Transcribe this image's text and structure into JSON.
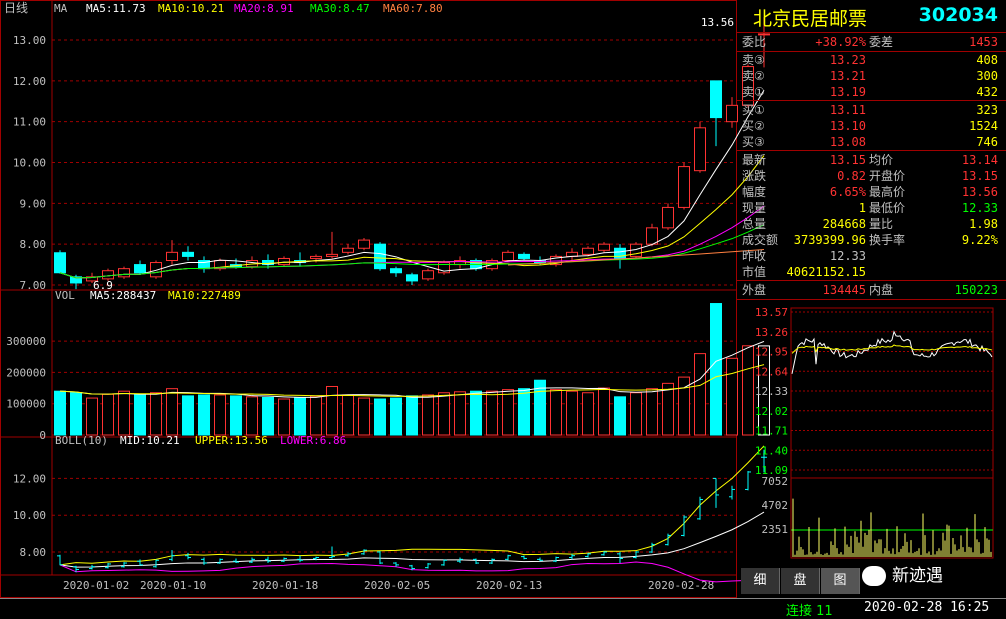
{
  "header": {
    "period": "日线",
    "ma_label": "MA",
    "ma5": "MA5:11.73",
    "ma10": "MA10:10.21",
    "ma20": "MA20:8.91",
    "ma30": "MA30:8.47",
    "ma60": "MA60:7.80"
  },
  "colors": {
    "up": "#ff3232",
    "down": "#00ffff",
    "ma5": "#ffffff",
    "ma10": "#ffff00",
    "ma20": "#ff00ff",
    "ma30": "#00ff00",
    "ma60": "#ff8040",
    "grid": "#a00000",
    "axis_text": "#c0c0c0"
  },
  "price_axis": {
    "ticks": [
      "13.00",
      "12.00",
      "11.00",
      "10.00",
      "9.00",
      "8.00",
      "7.00"
    ]
  },
  "price_annotations": {
    "high": "13.56",
    "low": "6.9"
  },
  "volume": {
    "label": "VOL",
    "ma5": "MA5:288437",
    "ma10": "MA10:227489",
    "ticks": [
      "300000",
      "200000",
      "100000",
      "0"
    ]
  },
  "boll": {
    "label": "BOLL(10)",
    "mid": "MID:10.21",
    "upper": "UPPER:13.56",
    "lower": "LOWER:6.86",
    "ticks": [
      "12.00",
      "10.00",
      "8.00"
    ]
  },
  "dates": [
    "2020-01-02",
    "2020-01-10",
    "2020-01-18",
    "2020-02-05",
    "2020-02-13",
    "2020-02-28"
  ],
  "stock": {
    "name": "北京民居邮票",
    "code": "302034"
  },
  "quote": {
    "weibi_label": "委比",
    "weibi": "+38.92%",
    "weicha_label": "委差",
    "weicha": "1453",
    "sells": [
      {
        "label": "卖③",
        "price": "13.23",
        "vol": "408"
      },
      {
        "label": "卖②",
        "price": "13.21",
        "vol": "300"
      },
      {
        "label": "卖①",
        "price": "13.19",
        "vol": "432"
      }
    ],
    "buys": [
      {
        "label": "买①",
        "price": "13.11",
        "vol": "323"
      },
      {
        "label": "买②",
        "price": "13.10",
        "vol": "1524"
      },
      {
        "label": "买③",
        "price": "13.08",
        "vol": "746"
      }
    ],
    "stats": [
      {
        "l1": "最新",
        "v1": "13.15",
        "l2": "均价",
        "v2": "13.14"
      },
      {
        "l1": "涨跌",
        "v1": "0.82",
        "l2": "开盘价",
        "v2": "13.15"
      },
      {
        "l1": "幅度",
        "v1": "6.65%",
        "l2": "最高价",
        "v2": "13.56"
      },
      {
        "l1": "现量",
        "v1": "1",
        "l2": "最低价",
        "v2": "12.33"
      },
      {
        "l1": "总量",
        "v1": "284668",
        "l2": "量比",
        "v2": "1.98"
      },
      {
        "l1": "成交额",
        "v1": "3739399.96",
        "l2": "换手率",
        "v2": "9.22%"
      },
      {
        "l1": "昨收",
        "v1": "12.33",
        "l2": "",
        "v2": ""
      },
      {
        "l1": "市值",
        "v1": "40621152.15",
        "l2": "",
        "v2": ""
      }
    ],
    "waipan_label": "外盘",
    "waipan": "134445",
    "neipan_label": "内盘",
    "neipan": "150223"
  },
  "intraday": {
    "price_ticks": [
      "13.57",
      "13.26",
      "12.95",
      "12.64",
      "12.33",
      "12.02",
      "11.71",
      "11.40",
      "11.09"
    ],
    "vol_ticks": [
      "7052",
      "4702",
      "2351"
    ]
  },
  "tabs": [
    "细",
    "盘",
    "图"
  ],
  "watermark": "新迹遇",
  "status": {
    "connection": "连接 11",
    "datetime": "2020-02-28 16:25"
  },
  "chart_data": {
    "type": "candlestick",
    "candles": [
      [
        7.79,
        7.3,
        7.85,
        7.28
      ],
      [
        7.2,
        7.05,
        7.25,
        6.9
      ],
      [
        7.1,
        7.2,
        7.3,
        7.05
      ],
      [
        7.15,
        7.35,
        7.4,
        7.1
      ],
      [
        7.2,
        7.4,
        7.45,
        7.15
      ],
      [
        7.5,
        7.3,
        7.6,
        7.25
      ],
      [
        7.2,
        7.55,
        7.6,
        7.15
      ],
      [
        7.6,
        7.8,
        8.1,
        7.5
      ],
      [
        7.8,
        7.7,
        7.95,
        7.6
      ],
      [
        7.6,
        7.4,
        7.7,
        7.3
      ],
      [
        7.4,
        7.6,
        7.65,
        7.35
      ],
      [
        7.5,
        7.45,
        7.65,
        7.4
      ],
      [
        7.45,
        7.6,
        7.7,
        7.4
      ],
      [
        7.6,
        7.5,
        7.75,
        7.4
      ],
      [
        7.5,
        7.65,
        7.7,
        7.45
      ],
      [
        7.6,
        7.55,
        7.8,
        7.45
      ],
      [
        7.65,
        7.7,
        7.75,
        7.55
      ],
      [
        7.7,
        7.75,
        8.3,
        7.65
      ],
      [
        7.8,
        7.9,
        8.0,
        7.75
      ],
      [
        7.9,
        8.1,
        8.15,
        7.85
      ],
      [
        8.0,
        7.4,
        8.05,
        7.35
      ],
      [
        7.4,
        7.3,
        7.45,
        7.2
      ],
      [
        7.25,
        7.1,
        7.3,
        7.0
      ],
      [
        7.15,
        7.35,
        7.4,
        7.1
      ],
      [
        7.3,
        7.55,
        7.6,
        7.25
      ],
      [
        7.5,
        7.6,
        7.7,
        7.4
      ],
      [
        7.6,
        7.4,
        7.65,
        7.35
      ],
      [
        7.4,
        7.6,
        7.65,
        7.35
      ],
      [
        7.6,
        7.8,
        7.85,
        7.55
      ],
      [
        7.75,
        7.65,
        7.8,
        7.6
      ],
      [
        7.6,
        7.55,
        7.7,
        7.5
      ],
      [
        7.5,
        7.7,
        7.75,
        7.45
      ],
      [
        7.7,
        7.8,
        7.9,
        7.6
      ],
      [
        7.75,
        7.9,
        7.95,
        7.7
      ],
      [
        7.85,
        8.0,
        8.05,
        7.8
      ],
      [
        7.9,
        7.65,
        8.0,
        7.4
      ],
      [
        7.7,
        8.0,
        8.05,
        7.65
      ],
      [
        8.0,
        8.4,
        8.5,
        7.95
      ],
      [
        8.4,
        8.9,
        9.0,
        8.35
      ],
      [
        8.9,
        9.9,
        10.0,
        8.85
      ],
      [
        9.8,
        10.85,
        11.0,
        9.75
      ],
      [
        12.0,
        11.1,
        12.0,
        10.4
      ],
      [
        11.0,
        11.4,
        11.6,
        10.85
      ],
      [
        11.4,
        12.35,
        12.4,
        11.35
      ],
      [
        13.15,
        13.15,
        13.56,
        12.33
      ]
    ],
    "volumes": [
      140000,
      135000,
      118000,
      130000,
      140000,
      128000,
      135000,
      148000,
      125000,
      128000,
      128000,
      125000,
      122000,
      120000,
      115000,
      120000,
      124000,
      155000,
      128000,
      118000,
      115000,
      118000,
      125000,
      128000,
      135000,
      138000,
      140000,
      140000,
      145000,
      148000,
      175000,
      145000,
      140000,
      135000,
      150000,
      122000,
      135000,
      148000,
      165000,
      185000,
      260000,
      420000,
      245000,
      285000,
      284668
    ]
  }
}
